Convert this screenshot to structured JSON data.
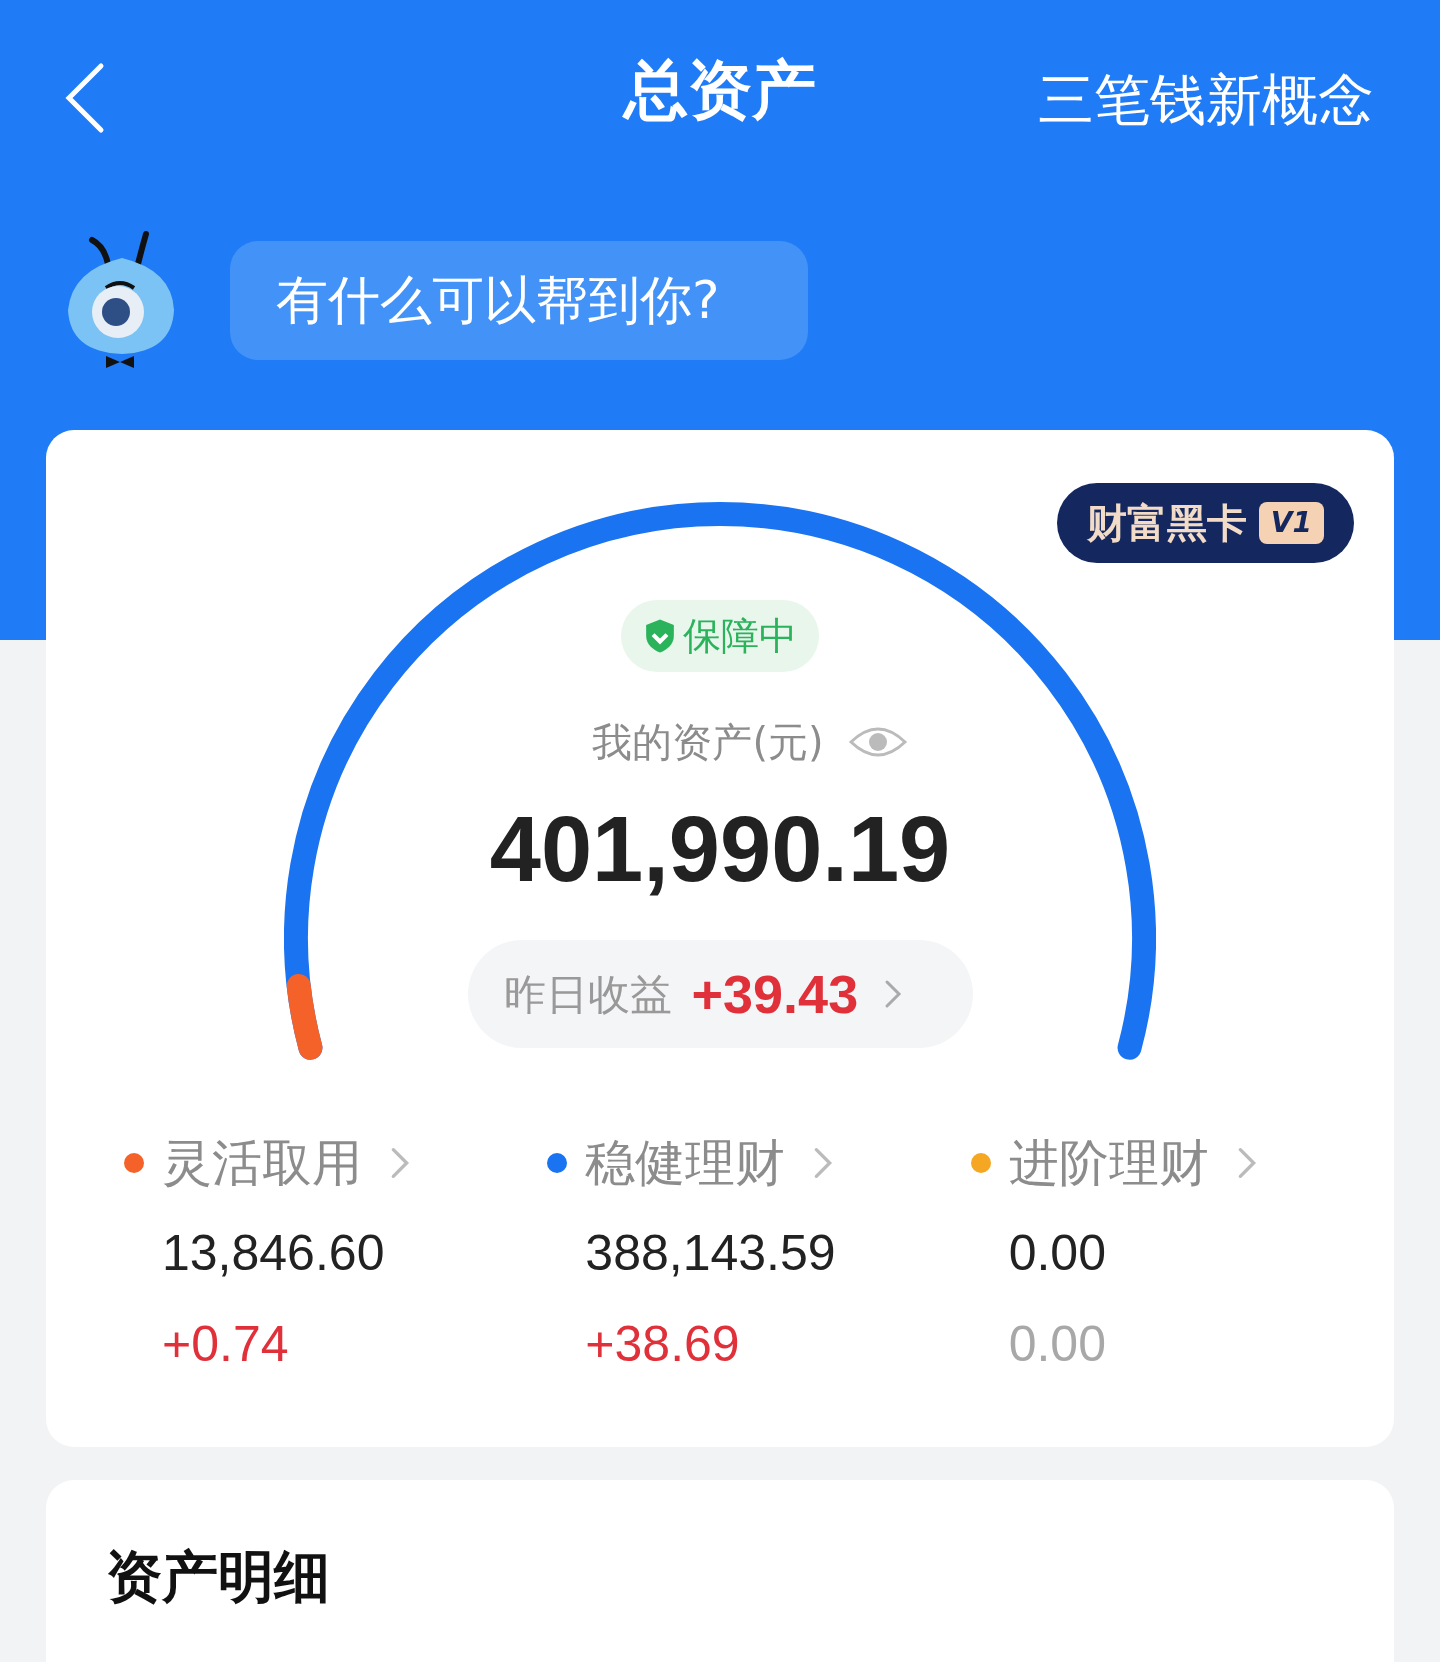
{
  "header": {
    "title": "总资产",
    "action": "三笔钱新概念"
  },
  "assistant": {
    "prompt": "有什么可以帮到你?"
  },
  "summary": {
    "badge": "财富黑卡",
    "badge_level": "V1",
    "status": "保障中",
    "label": "我的资产(元)",
    "total": "401,990.19",
    "yesterday_label": "昨日收益",
    "yesterday_value": "+39.43"
  },
  "categories": [
    {
      "name": "灵活取用",
      "color": "#f4622a",
      "amount": "13,846.60",
      "change": "+0.74",
      "highlighted": true
    },
    {
      "name": "稳健理财",
      "color": "#1a73f0",
      "amount": "388,143.59",
      "change": "+38.69",
      "highlighted": true
    },
    {
      "name": "进阶理财",
      "color": "#f5a623",
      "amount": "0.00",
      "change": "0.00",
      "highlighted": false
    }
  ],
  "details": {
    "title": "资产明细"
  }
}
